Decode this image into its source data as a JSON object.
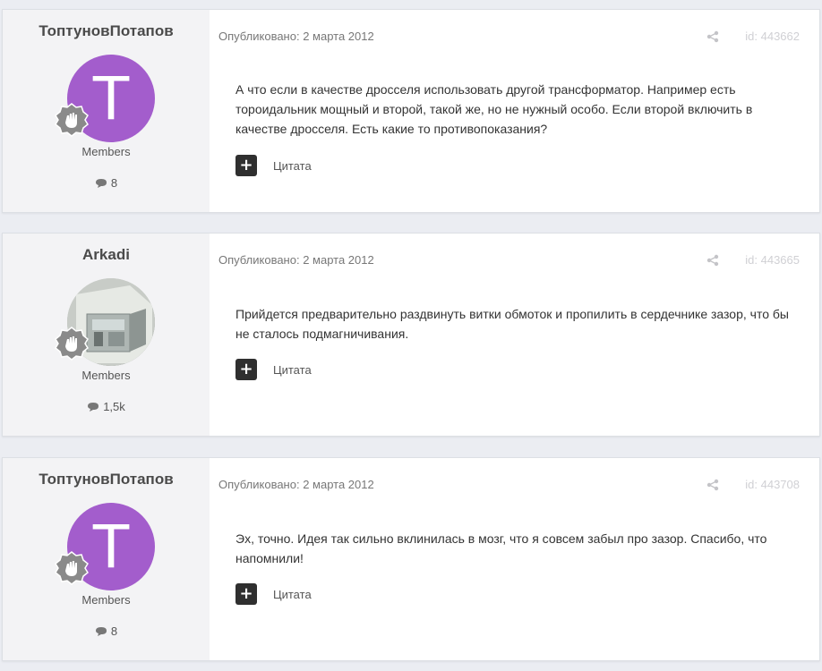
{
  "posts": [
    {
      "author": "ТоптуновПотапов",
      "avatar_letter": "T",
      "avatar_type": "letter",
      "group": "Members",
      "post_count": "8",
      "published": "Опубликовано: 2 марта 2012",
      "post_id": "id: 443662",
      "body": "А что если в качестве дросселя использовать другой трансформатор. Например есть тороидальник мощный и второй, такой же, но не нужный особо. Если второй включить в качестве дросселя. Есть какие то противопоказания?",
      "quote_label": "Цитата",
      "plus_label": "+"
    },
    {
      "author": "Arkadi",
      "avatar_letter": "",
      "avatar_type": "photo",
      "group": "Members",
      "post_count": "1,5k",
      "published": "Опубликовано: 2 марта 2012",
      "post_id": "id: 443665",
      "body": "Прийдется предварительно раздвинуть витки обмоток и пропилить в сердечнике зазор, что бы не сталось подмагничивания.",
      "quote_label": "Цитата",
      "plus_label": "+"
    },
    {
      "author": "ТоптуновПотапов",
      "avatar_letter": "T",
      "avatar_type": "letter",
      "group": "Members",
      "post_count": "8",
      "published": "Опубликовано: 2 марта 2012",
      "post_id": "id: 443708",
      "body": "Эх, точно. Идея так сильно вклинилась в мозг, что я совсем забыл про зазор. Спасибо, что напомнили!",
      "quote_label": "Цитата",
      "plus_label": "+"
    }
  ],
  "colors": {
    "avatar_letter_bg": "#a35dcc",
    "page_bg": "#ebedf2",
    "author_panel_bg": "#f3f3f5"
  },
  "icons": {
    "badge": "wave-hand-badge-icon",
    "comment": "comment-bubble-icon",
    "share": "share-icon"
  }
}
